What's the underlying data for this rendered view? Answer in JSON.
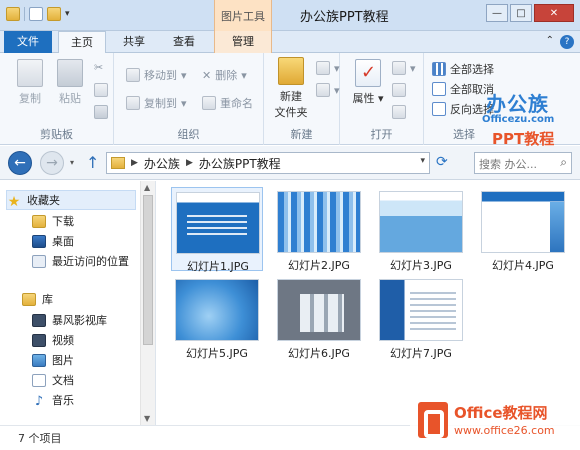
{
  "window": {
    "title": "办公族PPT教程",
    "context_group": "图片工具"
  },
  "tabs": {
    "file": "文件",
    "home": "主页",
    "share": "共享",
    "view": "查看",
    "manage": "管理"
  },
  "ribbon": {
    "clipboard": {
      "copy": "复制",
      "paste": "粘贴",
      "label": "剪贴板"
    },
    "organize": {
      "move_to": "移动到",
      "copy_to": "复制到",
      "delete": "删除",
      "rename": "重命名",
      "label": "组织"
    },
    "new": {
      "new_folder_line1": "新建",
      "new_folder_line2": "文件夹",
      "label": "新建"
    },
    "open": {
      "properties": "属性",
      "label": "打开"
    },
    "select": {
      "select_all": "全部选择",
      "select_none": "全部取消",
      "invert": "反向选择",
      "label": "选择"
    }
  },
  "address": {
    "crumbs": [
      "办公族",
      "办公族PPT教程"
    ],
    "search_placeholder": "搜索 办公..."
  },
  "nav": {
    "favorites": "收藏夹",
    "downloads": "下载",
    "desktop": "桌面",
    "recent": "最近访问的位置",
    "libraries": "库",
    "videos_lib": "暴风影视库",
    "videos": "视频",
    "pictures": "图片",
    "documents": "文档",
    "music": "音乐"
  },
  "files": [
    {
      "name": "幻灯片1.JPG"
    },
    {
      "name": "幻灯片2.JPG"
    },
    {
      "name": "幻灯片3.JPG"
    },
    {
      "name": "幻灯片4.JPG"
    },
    {
      "name": "幻灯片5.JPG"
    },
    {
      "name": "幻灯片6.JPG"
    },
    {
      "name": "幻灯片7.JPG"
    }
  ],
  "status": {
    "item_count": "7 个项目"
  },
  "watermarks": {
    "top_brand": "办公族",
    "top_site": "Officezu.com",
    "top_ppt": "PPT教程",
    "bottom_brand": "Office教程网",
    "bottom_site": "www.office26.com"
  },
  "colors": {
    "accent": "#1e6fbf",
    "context_tab": "#fde2c4",
    "selection": "#e9f2fd",
    "watermark_orange": "#e8542a"
  }
}
